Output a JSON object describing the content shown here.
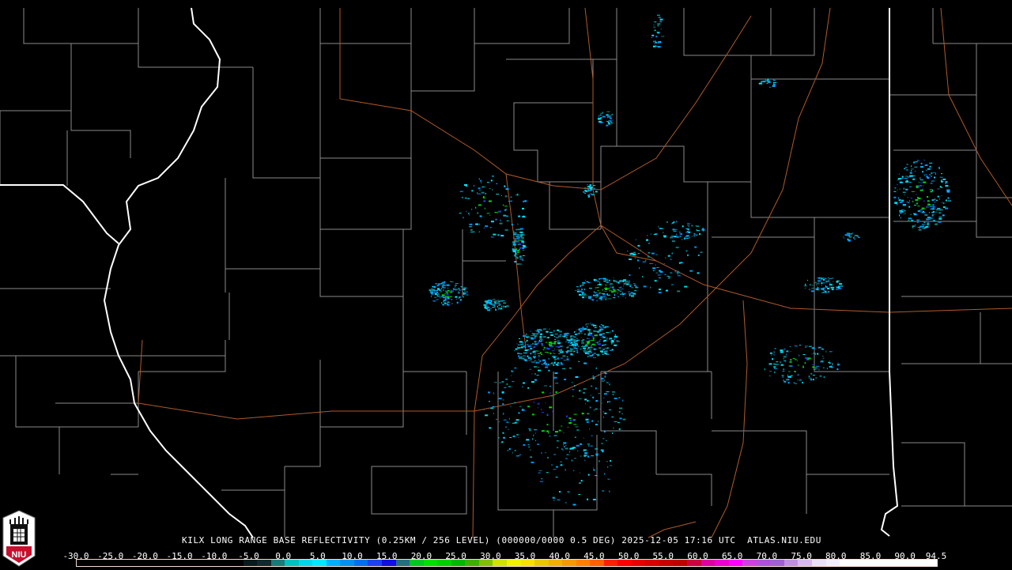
{
  "caption": {
    "station": "KILX",
    "product": "LONG RANGE BASE REFLECTIVITY (0.25KM / 256 LEVEL)",
    "volume": "(000000/0000 0.5 DEG)",
    "datetime": "2025-12-05 17:16 UTC",
    "site": "ATLAS.NIU.EDU"
  },
  "logo": {
    "text": "NIU"
  },
  "scale": {
    "labels": [
      "-30.0",
      "-25.0",
      "-20.0",
      "-15.0",
      "-10.0",
      "-5.0",
      "0.0",
      "5.0",
      "10.0",
      "15.0",
      "20.0",
      "25.0",
      "30.0",
      "35.0",
      "40.0",
      "45.0",
      "50.0",
      "55.0",
      "60.0",
      "65.0",
      "70.0",
      "75.0",
      "80.0",
      "85.0",
      "90.0",
      "94.5"
    ],
    "min": -30,
    "max": 94.5,
    "colors": [
      "#000000",
      "#000000",
      "#000000",
      "#000000",
      "#000000",
      "#000000",
      "#000000",
      "#000000",
      "#000000",
      "#000000",
      "#000000",
      "#000000",
      "#0a1a1a",
      "#0f2a2a",
      "#1a7a7a",
      "#00c0c0",
      "#00d8e8",
      "#00e8ff",
      "#00b0ff",
      "#0090f0",
      "#0070f0",
      "#2040f0",
      "#1010e0",
      "#207080",
      "#00c820",
      "#00e000",
      "#00d000",
      "#00b800",
      "#40b000",
      "#80c000",
      "#d0e000",
      "#f0f000",
      "#f8e000",
      "#e8c800",
      "#f0b000",
      "#f89800",
      "#ff8000",
      "#ff6000",
      "#ff2000",
      "#ff0000",
      "#e80000",
      "#d80000",
      "#c80000",
      "#c00000",
      "#d00040",
      "#e000a0",
      "#f000d0",
      "#ff00ff",
      "#d040e0",
      "#b050d8",
      "#a060d0",
      "#c090e0",
      "#d8b8f0",
      "#ece0f8",
      "#f4eefc",
      "#ffffff",
      "#ffffff",
      "#ffffff",
      "#ffffff",
      "#ffffff",
      "#ffffff",
      "#ffffff"
    ]
  }
}
